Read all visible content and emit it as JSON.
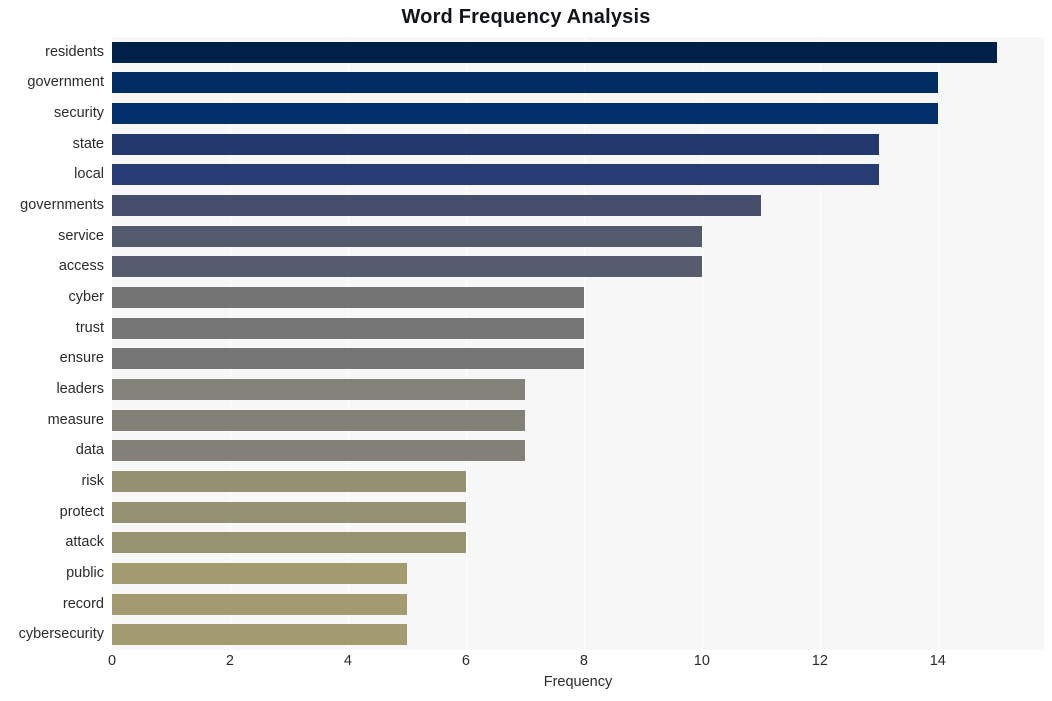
{
  "chart_data": {
    "type": "bar",
    "orientation": "horizontal",
    "title": "Word Frequency Analysis",
    "xlabel": "Frequency",
    "ylabel": "",
    "xlim": [
      0,
      15.8
    ],
    "xticks": [
      0,
      2,
      4,
      6,
      8,
      10,
      12,
      14
    ],
    "grid": "vertical-white-on-gray",
    "legend": "none",
    "categories": [
      "residents",
      "government",
      "security",
      "state",
      "local",
      "governments",
      "service",
      "access",
      "cyber",
      "trust",
      "ensure",
      "leaders",
      "measure",
      "data",
      "risk",
      "protect",
      "attack",
      "public",
      "record",
      "cybersecurity"
    ],
    "values": [
      15,
      14,
      14,
      13,
      13,
      11,
      10,
      10,
      8,
      8,
      8,
      7,
      7,
      7,
      6,
      6,
      6,
      5,
      5,
      5
    ],
    "bar_colors": [
      "#002147",
      "#012d62",
      "#03306a",
      "#23386c",
      "#263c72",
      "#464e6c",
      "#545a6d",
      "#565c6e",
      "#747474",
      "#757575",
      "#757575",
      "#82817a",
      "#828178",
      "#838177",
      "#959071",
      "#969170",
      "#97926f",
      "#a49a6f",
      "#a49a6f",
      "#a49a6f"
    ],
    "plot_background": "#f7f7f7",
    "figure_background": "#ffffff",
    "title_color": "#111418",
    "tick_label_color": "#2b2b2b"
  }
}
